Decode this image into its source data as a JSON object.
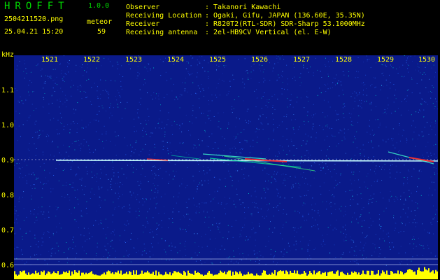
{
  "app": {
    "name": "HROFFT",
    "version": "1.0.0"
  },
  "file": {
    "name": "2504211520.png",
    "timestamp": "25.04.21 15:20"
  },
  "detection": {
    "label": "meteor",
    "count": "59"
  },
  "info": {
    "rows": [
      {
        "key": "Observer",
        "value": ": Takanori Kawachi"
      },
      {
        "key": "Receiving Location",
        "value": ": Ogaki, Gifu, JAPAN (136.60E, 35.35N)"
      },
      {
        "key": "Receiver",
        "value": ": R820T2(RTL-SDR) SDR-Sharp 53.1000MHz"
      },
      {
        "key": "Receiving antenna",
        "value": ": 2el-HB9CV Vertical (el. E-W)"
      }
    ]
  },
  "axes": {
    "y_unit": "kHz",
    "y_ticks": [
      "1.1",
      "1.0",
      "0.9",
      "0.8",
      "0.7",
      "0.6"
    ],
    "x_ticks": [
      "1521",
      "1522",
      "1523",
      "1524",
      "1525",
      "1526",
      "1527",
      "1528",
      "1529",
      "1530"
    ]
  },
  "colors": {
    "background": "#0a1a8a",
    "label": "#ffff00",
    "title": "#00d800",
    "signal_line": "#c8ffff",
    "meteor_hot": "#ff2a2a",
    "noise_floor": "#ffff00"
  }
}
